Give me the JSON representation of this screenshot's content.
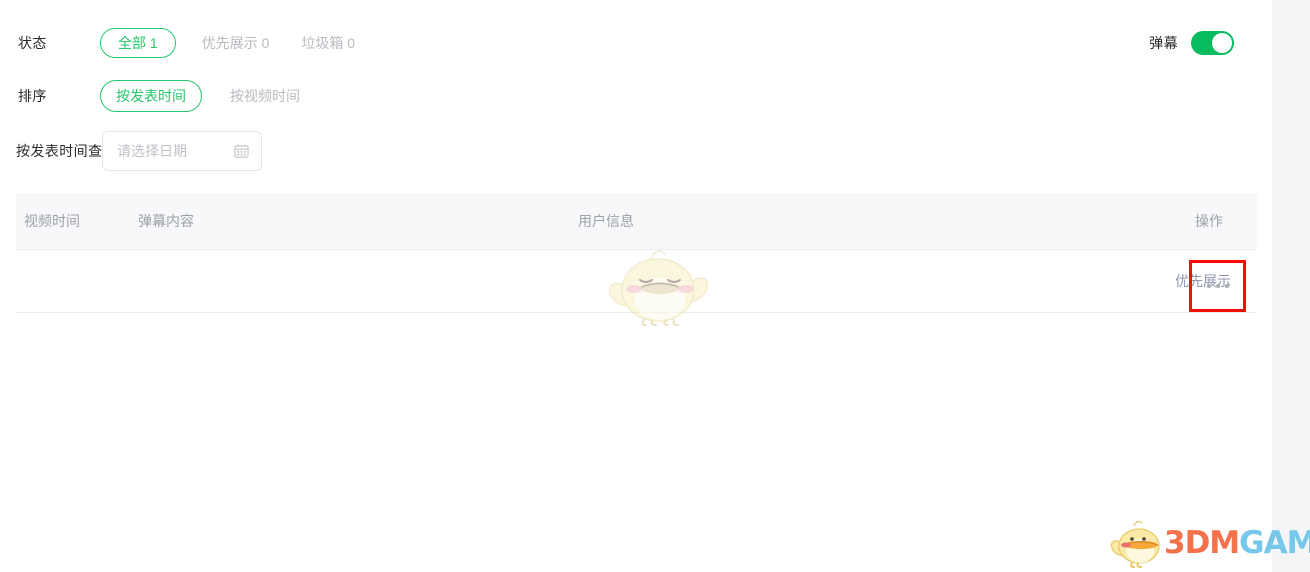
{
  "filters": {
    "status": {
      "label": "状态",
      "tabs": [
        {
          "label": "全部 1",
          "selected": true
        },
        {
          "label": "优先展示 0",
          "selected": false
        },
        {
          "label": "垃圾箱 0",
          "selected": false
        }
      ]
    },
    "sort": {
      "label": "排序",
      "tabs": [
        {
          "label": "按发表时间",
          "selected": true
        },
        {
          "label": "按视频时间",
          "selected": false
        }
      ]
    },
    "date": {
      "label": "按发表时间查找",
      "placeholder": "请选择日期",
      "value": "",
      "icon": "calendar-icon"
    }
  },
  "danmaku_toggle": {
    "label": "弹幕",
    "state": "on",
    "on_color": "#09bb5f"
  },
  "table": {
    "columns": [
      {
        "key": "video_time",
        "label": "视频时间"
      },
      {
        "key": "danmaku_content",
        "label": "弹幕内容"
      },
      {
        "key": "user_info",
        "label": "用户信息"
      },
      {
        "key": "action",
        "label": "操作"
      }
    ],
    "rows": [
      {
        "video_time": "",
        "danmaku_content": "",
        "user_info": "",
        "action_link": "优先展示",
        "more_icon": "ellipsis-icon",
        "redacted": true
      }
    ]
  },
  "highlight": {
    "target": "more-menu",
    "color": "#fb0d07"
  },
  "watermark": {
    "chick": "chick-mascot-icon",
    "logo_primary": "3DM",
    "logo_secondary": "GAME",
    "logo_primary_color": "#f4714b",
    "logo_secondary_color": "#76c7ea"
  }
}
